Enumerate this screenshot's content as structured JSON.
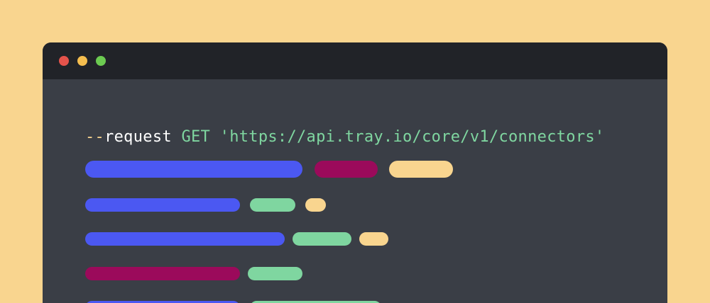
{
  "colors": {
    "background": "#F9D58F",
    "titlebar": "#212328",
    "editor": "#3A3E46",
    "close": "#E5534B",
    "minimize": "#F5BE4F",
    "zoom": "#6CCB51",
    "flag_dashes": "#F9D58F",
    "flag_text": "#FFFFFF",
    "method": "#7FD6A0",
    "url": "#7FD6A0",
    "blue": "#4B58F2",
    "magenta": "#9B0A5B",
    "green": "#7FD6A0",
    "peach": "#F9D58F"
  },
  "window": {
    "controls": [
      "close",
      "minimize",
      "zoom"
    ]
  },
  "code": {
    "dashes": "--",
    "flag": "request",
    "method": "GET",
    "url": "'https://api.tray.io/core/v1/connectors'"
  },
  "placeholder_lines": [
    [
      {
        "color": "blue"
      },
      {
        "color": "magenta"
      },
      {
        "color": "peach"
      }
    ],
    [
      {
        "color": "blue"
      },
      {
        "color": "green"
      },
      {
        "color": "peach"
      }
    ],
    [
      {
        "color": "blue"
      },
      {
        "color": "green"
      },
      {
        "color": "peach"
      }
    ],
    [
      {
        "color": "magenta"
      },
      {
        "color": "green"
      }
    ],
    [
      {
        "color": "blue"
      },
      {
        "color": "green"
      }
    ]
  ]
}
